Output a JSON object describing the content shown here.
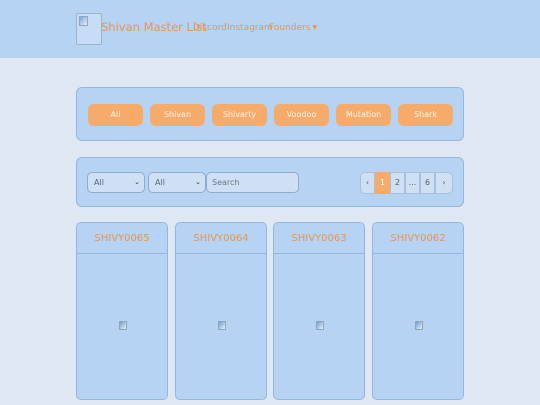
{
  "navbar": {
    "brand": "Shivan Master List",
    "links": [
      "Discord",
      "Instagram",
      "Founders"
    ]
  },
  "filters": [
    "All",
    "Shivan",
    "Shivarty",
    "Voodoo",
    "Mutation",
    "Shark"
  ],
  "search_bar": {
    "select1": "All",
    "select2": "All",
    "search_placeholder": "Search",
    "pagination": {
      "prev": "‹",
      "pages": [
        "1",
        "2",
        "...",
        "6"
      ],
      "next": "›",
      "active": "1"
    }
  },
  "cards": [
    "SHIVY0065",
    "SHIVY0064",
    "SHIVY0063",
    "SHIVY0062"
  ],
  "colors": {
    "accent": "#f7ab6b",
    "panel": "#b6d3f4",
    "background": "#dfe7f3"
  }
}
